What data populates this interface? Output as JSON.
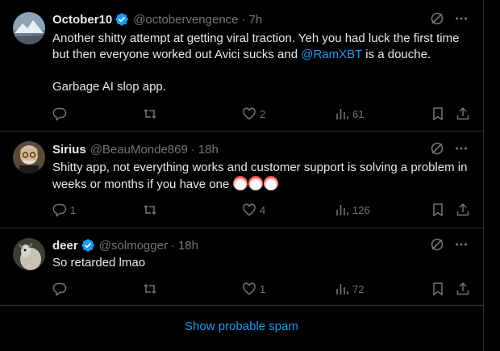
{
  "tweets": [
    {
      "name": "October10",
      "handle": "@octobervengence",
      "time": "7h",
      "text_a": "Another shitty attempt at getting viral traction. Yeh you had luck the first time but then everyone worked out Avici sucks and ",
      "mention": "@RamXBT",
      "text_b": " is a douche.",
      "text_c": "Garbage AI slop app.",
      "replies": "",
      "retweets": "",
      "likes": "2",
      "views": "61"
    },
    {
      "name": "Sirius",
      "handle": "@BeauMonde869",
      "time": "18h",
      "text_a": "Shitty app, not everything works and customer support is solving a problem in weeks or months if you have one",
      "emojis": [
        "clown-face",
        "clown-face",
        "clown-face"
      ],
      "replies": "1",
      "retweets": "",
      "likes": "4",
      "views": "126"
    },
    {
      "name": "deer",
      "handle": "@solmogger",
      "time": "18h",
      "text_a": "So retarded lmao",
      "replies": "",
      "retweets": "",
      "likes": "1",
      "views": "72"
    }
  ],
  "separator": "·",
  "spam_link": "Show probable spam",
  "colors": {
    "accent": "#1d9bf0",
    "muted": "#71767b",
    "text": "#e7e9ea",
    "border": "#2f3336"
  }
}
